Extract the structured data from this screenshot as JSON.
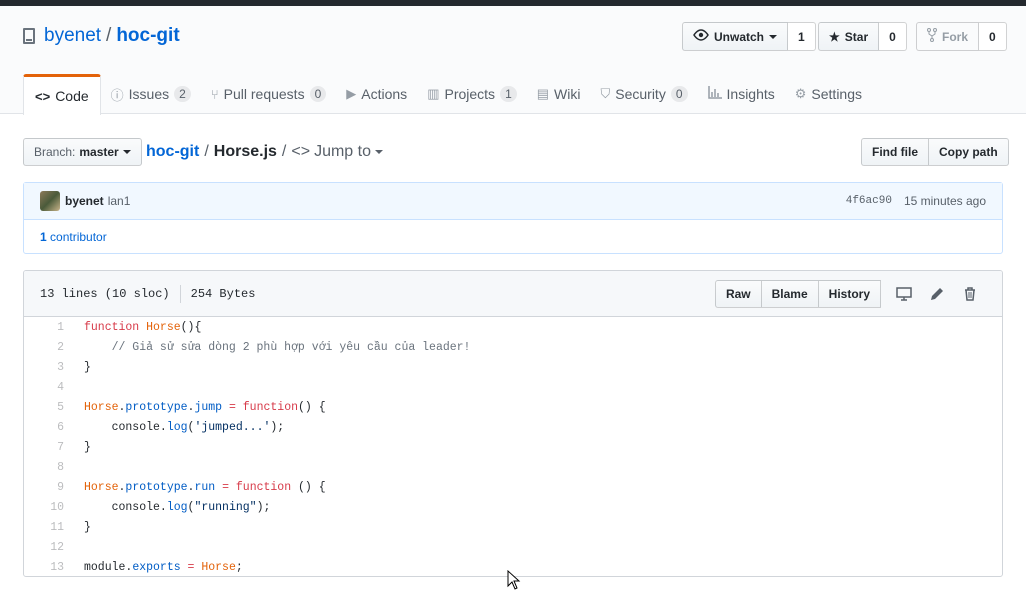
{
  "repo": {
    "owner": "byenet",
    "separator": "/",
    "name": "hoc-git"
  },
  "actions": {
    "watch": {
      "label": "Unwatch",
      "count": "1"
    },
    "star": {
      "label": "Star",
      "count": "0"
    },
    "fork": {
      "label": "Fork",
      "count": "0"
    }
  },
  "tabs": [
    {
      "label": "Code",
      "icon": "code-icon",
      "counter": ""
    },
    {
      "label": "Issues",
      "icon": "issue-icon",
      "counter": "2"
    },
    {
      "label": "Pull requests",
      "icon": "pull-request-icon",
      "counter": "0"
    },
    {
      "label": "Actions",
      "icon": "play-icon",
      "counter": ""
    },
    {
      "label": "Projects",
      "icon": "project-icon",
      "counter": "1"
    },
    {
      "label": "Wiki",
      "icon": "book-icon",
      "counter": ""
    },
    {
      "label": "Security",
      "icon": "shield-icon",
      "counter": "0"
    },
    {
      "label": "Insights",
      "icon": "graph-icon",
      "counter": ""
    },
    {
      "label": "Settings",
      "icon": "gear-icon",
      "counter": ""
    }
  ],
  "branch": {
    "label": "Branch:",
    "value": "master"
  },
  "breadcrumb": {
    "repo": "hoc-git",
    "sep": "/",
    "file": "Horse.js",
    "sep2": "/",
    "jump": "Jump to"
  },
  "file_buttons": {
    "find": "Find file",
    "copy": "Copy path"
  },
  "commit": {
    "author": "byenet",
    "message": "lan1",
    "sha": "4f6ac90",
    "time": "15 minutes ago",
    "contributors_count": "1",
    "contributors_label": "contributor"
  },
  "file_info": {
    "lines": "13 lines (10 sloc)",
    "size": "254 Bytes"
  },
  "view_buttons": {
    "raw": "Raw",
    "blame": "Blame",
    "history": "History"
  },
  "code_lines": [
    "function Horse(){",
    "    // Giả sử sửa dòng 2 phù hợp với yêu cầu của leader!",
    "}",
    "",
    "Horse.prototype.jump = function() {",
    "    console.log('jumped...');",
    "}",
    "",
    "Horse.prototype.run = function () {",
    "    console.log(\"running\");",
    "}",
    "",
    "module.exports = Horse;"
  ],
  "colors": {
    "accent": "#e36209",
    "link": "#0366d6",
    "keyword": "#d73a49",
    "comment": "#6a737d"
  }
}
